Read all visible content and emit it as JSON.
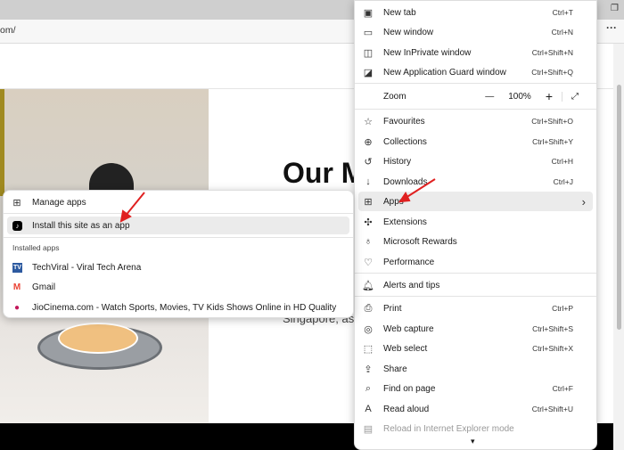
{
  "browser": {
    "url_fragment": "om/",
    "more_icon": "ellipsis-icon",
    "restore_icon": "restore-icon"
  },
  "page": {
    "heading": "Our M",
    "location_text": "Singapore, as"
  },
  "menu": {
    "items": [
      {
        "label": "New tab",
        "shortcut": "Ctrl+T",
        "icon": "new-tab-icon"
      },
      {
        "label": "New window",
        "shortcut": "Ctrl+N",
        "icon": "window-icon"
      },
      {
        "label": "New InPrivate window",
        "shortcut": "Ctrl+Shift+N",
        "icon": "inprivate-icon"
      },
      {
        "label": "New Application Guard window",
        "shortcut": "Ctrl+Shift+Q",
        "icon": "app-guard-icon"
      },
      {
        "label": "Favourites",
        "shortcut": "Ctrl+Shift+O",
        "icon": "favourites-icon"
      },
      {
        "label": "Collections",
        "shortcut": "Ctrl+Shift+Y",
        "icon": "collections-icon"
      },
      {
        "label": "History",
        "shortcut": "Ctrl+H",
        "icon": "history-icon"
      },
      {
        "label": "Downloads",
        "shortcut": "Ctrl+J",
        "icon": "download-icon"
      },
      {
        "label": "Apps",
        "shortcut": "",
        "icon": "apps-icon"
      },
      {
        "label": "Extensions",
        "shortcut": "",
        "icon": "extensions-icon"
      },
      {
        "label": "Microsoft Rewards",
        "shortcut": "",
        "icon": "rewards-icon"
      },
      {
        "label": "Performance",
        "shortcut": "",
        "icon": "performance-icon"
      },
      {
        "label": "Alerts and tips",
        "shortcut": "",
        "icon": "bell-icon"
      },
      {
        "label": "Print",
        "shortcut": "Ctrl+P",
        "icon": "print-icon"
      },
      {
        "label": "Web capture",
        "shortcut": "Ctrl+Shift+S",
        "icon": "web-capture-icon"
      },
      {
        "label": "Web select",
        "shortcut": "Ctrl+Shift+X",
        "icon": "web-select-icon"
      },
      {
        "label": "Share",
        "shortcut": "",
        "icon": "share-icon"
      },
      {
        "label": "Find on page",
        "shortcut": "Ctrl+F",
        "icon": "find-icon"
      },
      {
        "label": "Read aloud",
        "shortcut": "Ctrl+Shift+U",
        "icon": "read-aloud-icon"
      },
      {
        "label": "Reload in Internet Explorer mode",
        "shortcut": "",
        "icon": "ie-mode-icon",
        "disabled": true
      }
    ],
    "zoom": {
      "label": "Zoom",
      "value": "100%",
      "minus": "—",
      "plus": "+"
    }
  },
  "apps_submenu": {
    "manage": "Manage apps",
    "install": "Install this site as an app",
    "installed_label": "Installed apps",
    "installed": [
      {
        "name": "TechViral - Viral Tech Arena",
        "color": "#2d5aa0"
      },
      {
        "name": "Gmail",
        "color": "#ea4335"
      },
      {
        "name": "JioCinema.com - Watch Sports, Movies, TV  Kids Shows Online in HD Quality",
        "color": "#c2185b"
      }
    ]
  },
  "colors": {
    "annotation_arrow": "#e02020",
    "highlight": "#ebebeb"
  }
}
